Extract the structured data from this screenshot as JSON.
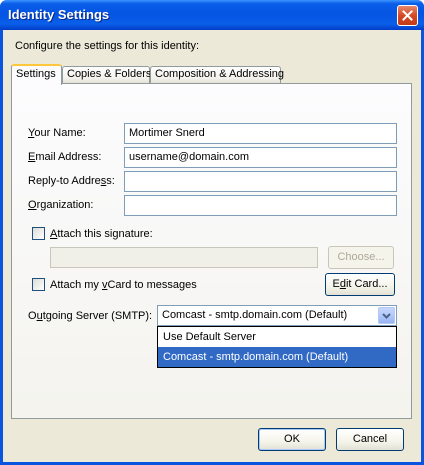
{
  "window": {
    "title": "Identity Settings"
  },
  "intro": "Configure the settings for this identity:",
  "tabs": [
    {
      "label": "Settings"
    },
    {
      "label": "Copies & Folders"
    },
    {
      "label": "Composition & Addressing"
    }
  ],
  "form": {
    "your_name": {
      "label_pre": "",
      "label_u": "Y",
      "label_post": "our Name:",
      "value": "Mortimer Snerd"
    },
    "email": {
      "label_pre": "",
      "label_u": "E",
      "label_post": "mail Address:",
      "value": "username@domain.com"
    },
    "reply_to": {
      "label_pre": "Reply-to Addre",
      "label_u": "s",
      "label_post": "s:",
      "value": ""
    },
    "organization": {
      "label_pre": "",
      "label_u": "O",
      "label_post": "rganization:",
      "value": ""
    },
    "signature": {
      "label_pre": "",
      "label_u": "A",
      "label_post": "ttach this signature:",
      "checked": false,
      "path": ""
    },
    "choose_button": "Choose...",
    "vcard": {
      "label_pre": "Attach my ",
      "label_u": "v",
      "label_post": "Card to messages",
      "checked": false
    },
    "edit_card_button": {
      "pre": "E",
      "u": "d",
      "post": "it Card..."
    },
    "smtp": {
      "label_pre": "O",
      "label_u": "u",
      "label_post": "tgoing Server (SMTP):",
      "selected": "Comcast - smtp.domain.com (Default)",
      "options": [
        "Use Default Server",
        "Comcast - smtp.domain.com (Default)"
      ]
    }
  },
  "buttons": {
    "ok": "OK",
    "cancel": "Cancel"
  },
  "colors": {
    "titlebar": "#0554e3",
    "dialog_bg": "#ece9d8",
    "selection": "#316ac5",
    "tab_highlight": "#ffc83c"
  }
}
